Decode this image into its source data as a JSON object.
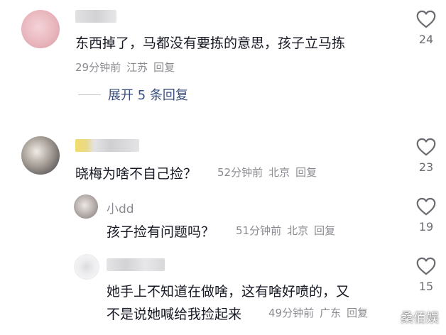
{
  "comments": [
    {
      "text": "东西掉了，马都没有要拣的意思，孩子立马拣",
      "time": "29分钟前",
      "location": "江苏",
      "reply": "回复",
      "likes": "24",
      "expand": "展开 5 条回复"
    },
    {
      "text": "晓梅为啥不自己捡？",
      "time": "52分钟前",
      "location": "北京",
      "reply": "回复",
      "likes": "23"
    }
  ],
  "replies": [
    {
      "username": "小dd",
      "text": "孩子捡有问题吗？",
      "time": "51分钟前",
      "location": "北京",
      "reply": "回复",
      "likes": "19"
    },
    {
      "text_line1": "她手上不知道在做啥，这有啥好喷的，又",
      "text_line2": "不是说她喊给我捡起来",
      "time": "49分钟前",
      "location": "广东",
      "reply": "回复",
      "likes": "15"
    }
  ],
  "watermark": "桑佰娱",
  "colors": {
    "text": "#161823",
    "meta": "#8a8b91",
    "link": "#3a4e7c"
  },
  "icons": [
    "heart-outline-icon"
  ]
}
